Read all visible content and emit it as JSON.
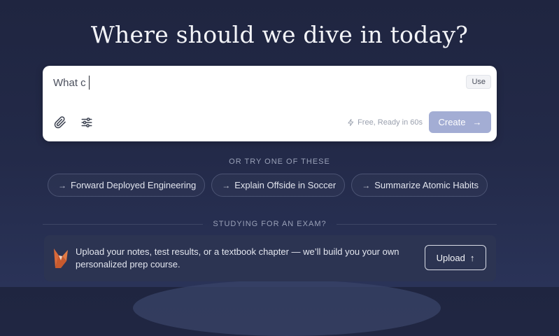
{
  "headline": "Where should we dive in today?",
  "composer": {
    "value": "What c",
    "use_label": "Use",
    "attach_icon": "paperclip-icon",
    "settings_icon": "sliders-icon",
    "ready_hint": "Free, Ready in 60s",
    "ready_icon": "lightning-icon",
    "create_label": "Create",
    "create_arrow": "→"
  },
  "suggestions": {
    "label": "OR TRY ONE OF THESE",
    "items": [
      {
        "arrow": "→",
        "label": "Forward Deployed Engineering"
      },
      {
        "arrow": "→",
        "label": "Explain Offside in Soccer"
      },
      {
        "arrow": "→",
        "label": "Summarize Atomic Habits"
      }
    ]
  },
  "exam": {
    "divider_label": "STUDYING FOR AN EXAM?",
    "description": "Upload your notes, test results, or a textbook chapter — we’ll build you your own personalized prep course.",
    "upload_label": "Upload",
    "upload_arrow": "↑",
    "logo_icon": "fox-logo-icon"
  },
  "colors": {
    "background": "#232a49",
    "create_button": "#a3add4",
    "card": "#2c3452",
    "fox_orange": "#d9693a"
  }
}
